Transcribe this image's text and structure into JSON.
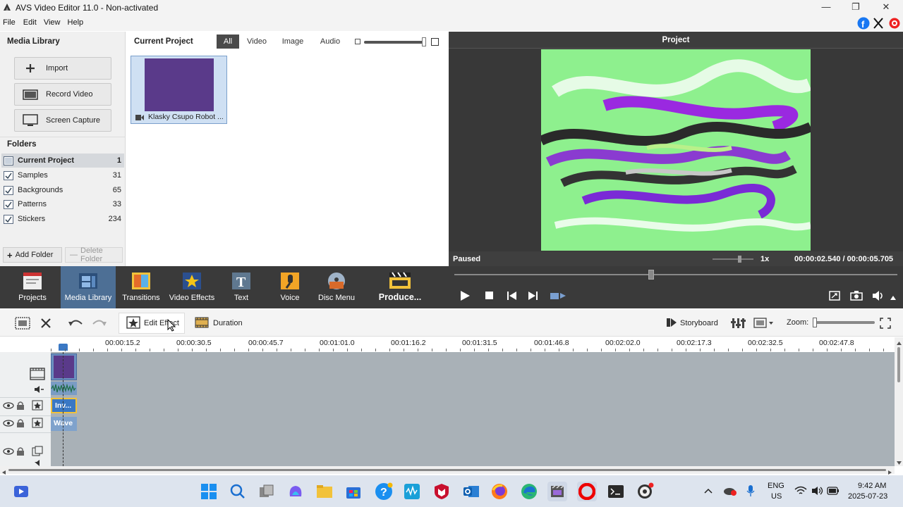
{
  "window": {
    "title": "AVS Video Editor 11.0 - Non-activated"
  },
  "menu": [
    "File",
    "Edit",
    "View",
    "Help"
  ],
  "media_library": {
    "title": "Media Library",
    "buttons": {
      "import": "Import",
      "record": "Record Video",
      "capture": "Screen Capture"
    },
    "folders_title": "Folders",
    "folders": [
      {
        "name": "Current Project",
        "count": "1"
      },
      {
        "name": "Samples",
        "count": "31"
      },
      {
        "name": "Backgrounds",
        "count": "65"
      },
      {
        "name": "Patterns",
        "count": "33"
      },
      {
        "name": "Stickers",
        "count": "234"
      }
    ],
    "add_folder": "Add Folder",
    "delete_folder": "Delete Folder"
  },
  "project_panel": {
    "title": "Current Project",
    "tabs": [
      "All",
      "Video",
      "Image",
      "Audio"
    ],
    "active_tab": "All",
    "clip_name": "Klasky Csupo Robot ..."
  },
  "preview": {
    "title": "Project",
    "status": "Paused",
    "speed": "1x",
    "time": "00:00:02.540 / 00:00:05.705"
  },
  "toolbar": [
    "Projects",
    "Media Library",
    "Transitions",
    "Video Effects",
    "Text",
    "Voice",
    "Disc Menu",
    "Produce..."
  ],
  "timeline": {
    "edit_effect": "Edit Effect",
    "duration": "Duration",
    "storyboard": "Storyboard",
    "zoom": "Zoom:",
    "ruler": [
      "00:00:15.2",
      "00:00:30.5",
      "00:00:45.7",
      "00:01:01.0",
      "00:01:16.2",
      "00:01:31.5",
      "00:01:46.8",
      "00:02:02.0",
      "00:02:17.3",
      "00:02:32.5",
      "00:02:47.8"
    ],
    "effect_clips": [
      "Inv...",
      "Wave"
    ]
  },
  "taskbar": {
    "lang": "ENG",
    "region": "US",
    "time": "9:42 AM",
    "date": "2025-07-23"
  },
  "colors": {
    "accent": "#3a78c4",
    "dark": "#3a3a3a",
    "preview_bg": "#383838",
    "track": "#a9b1b7",
    "clip": "#5a3a8a"
  }
}
